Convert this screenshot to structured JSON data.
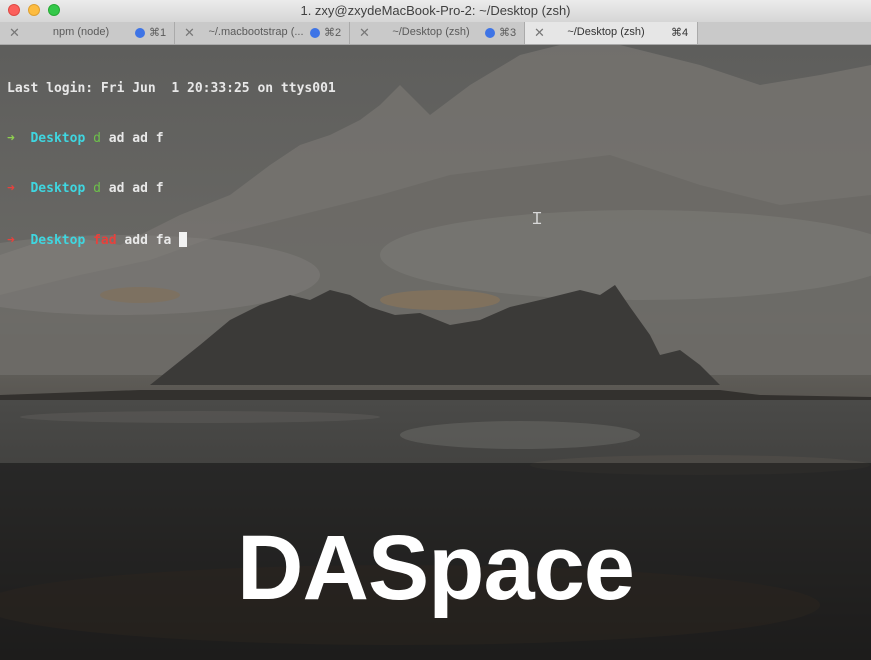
{
  "window": {
    "title": "1. zxy@zxydeMacBook-Pro-2: ~/Desktop (zsh)",
    "controls": [
      "close-icon",
      "minimize-icon",
      "zoom-icon"
    ]
  },
  "tabs": [
    {
      "close": "✕",
      "label": "npm (node)",
      "shortcut": "⌘1",
      "active": false
    },
    {
      "close": "✕",
      "label": "~/.macbootstrap (...",
      "shortcut": "⌘2",
      "active": false
    },
    {
      "close": "✕",
      "label": "~/Desktop (zsh)",
      "shortcut": "⌘3",
      "active": false
    },
    {
      "close": "✕",
      "label": "~/Desktop (zsh)",
      "shortcut": "⌘4",
      "active": true
    }
  ],
  "terminal": {
    "login": "Last login: Fri Jun  1 20:33:25 on ttys001",
    "lines": [
      {
        "arrow": "➜",
        "dir": "Desktop",
        "cmd": "d",
        "args": "ad ad f"
      },
      {
        "arrow": "➜",
        "dir": "Desktop",
        "cmd": "d",
        "args": "ad ad f"
      },
      {
        "arrow": "➜",
        "dir": "Desktop",
        "cmd": "fad",
        "args": "add fa"
      }
    ]
  },
  "overlay": {
    "brand": "DASpace"
  },
  "colors": {
    "prompt_ok": "#8fd14f",
    "prompt_error": "#e8413c",
    "directory": "#3fd6e0",
    "command_valid": "#6cc14a",
    "command_invalid": "#e8413c",
    "tab_indicator": "#3e74e6"
  }
}
